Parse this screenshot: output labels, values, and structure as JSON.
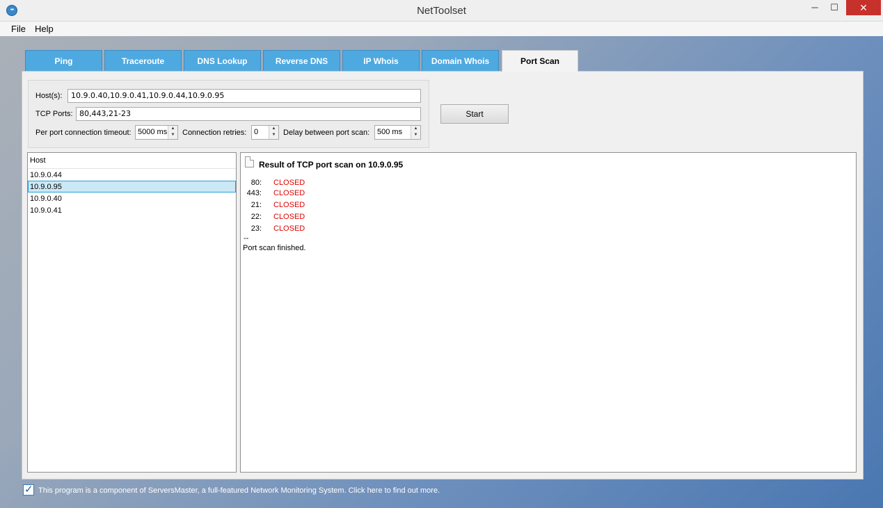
{
  "window": {
    "title": "NetToolset",
    "minimize_glyph": "─",
    "maximize_glyph": "☐",
    "close_glyph": "✕"
  },
  "menu": {
    "items": [
      "File",
      "Help"
    ]
  },
  "tabs": [
    {
      "label": "Ping",
      "active": false
    },
    {
      "label": "Traceroute",
      "active": false
    },
    {
      "label": "DNS Lookup",
      "active": false
    },
    {
      "label": "Reverse DNS",
      "active": false
    },
    {
      "label": "IP Whois",
      "active": false
    },
    {
      "label": "Domain Whois",
      "active": false
    },
    {
      "label": "Port Scan",
      "active": true
    }
  ],
  "form": {
    "hosts_label": "Host(s):",
    "hosts_value": "10.9.0.40,10.9.0.41,10.9.0.44,10.9.0.95",
    "ports_label": "TCP Ports:",
    "ports_value": "80,443,21-23",
    "timeout_label": "Per port connection timeout:",
    "timeout_value": "5000 ms",
    "retries_label": "Connection retries:",
    "retries_value": "0",
    "delay_label": "Delay between port scan:",
    "delay_value": "500 ms",
    "start_label": "Start"
  },
  "host_list": {
    "header": "Host",
    "rows": [
      "10.9.0.44",
      "10.9.0.95",
      "10.9.0.40",
      "10.9.0.41"
    ],
    "selected": "10.9.0.95"
  },
  "result": {
    "title": "Result of TCP port scan on 10.9.0.95",
    "ports": [
      {
        "port": "80:",
        "status": "CLOSED"
      },
      {
        "port": "443:",
        "status": "CLOSED"
      },
      {
        "port": "21:",
        "status": "CLOSED"
      },
      {
        "port": "22:",
        "status": "CLOSED"
      },
      {
        "port": "23:",
        "status": "CLOSED"
      }
    ],
    "separator": "--",
    "footer": "Port scan finished."
  },
  "status_bar": {
    "checked": true,
    "text": "This program is a component of ServersMaster, a full-featured Network Monitoring System. Click here to find out more."
  },
  "colors": {
    "tab_blue": "#4ea9e0",
    "closed_red": "#e00000",
    "selection": "#cbe8f6"
  }
}
